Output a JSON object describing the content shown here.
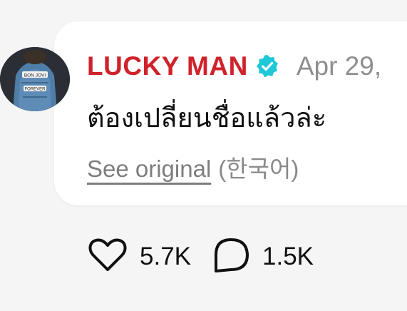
{
  "comment": {
    "author": "LUCKY MAN",
    "verified_color": "#1fc8d6",
    "date": "Apr 29,",
    "text": "ต้องเปลี่ยนชื่อแล้วล่ะ",
    "see_original_label": "See original",
    "original_language": "(한국어)",
    "author_color": "#d0222a",
    "avatar_text_top": "BON JOVI",
    "avatar_text_bottom": "FOREVER"
  },
  "actions": {
    "likes": "5.7K",
    "replies": "1.5K"
  },
  "icons": {
    "like": "heart-icon",
    "reply": "speech-bubble-icon",
    "verified": "verified-badge-icon"
  }
}
